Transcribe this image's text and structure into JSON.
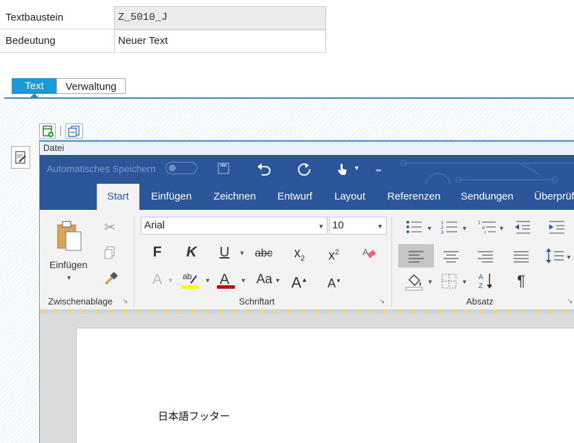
{
  "form": {
    "textbaustein_label": "Textbaustein",
    "textbaustein_value": "Z_5010_J",
    "bedeutung_label": "Bedeutung",
    "bedeutung_value": "Neuer Text"
  },
  "tabs": [
    {
      "label": "Text",
      "active": true
    },
    {
      "label": "Verwaltung",
      "active": false
    }
  ],
  "word": {
    "menu_label": "Datei",
    "autosave_label": "Automatisches Speichern",
    "ribbon_tabs": [
      "Start",
      "Einfügen",
      "Zeichnen",
      "Entwurf",
      "Layout",
      "Referenzen",
      "Sendungen",
      "Überprüfen"
    ],
    "active_ribbon_tab": "Start",
    "clipboard": {
      "paste_label": "Einfügen",
      "group_label": "Zwischenablage"
    },
    "font": {
      "family": "Arial",
      "size": "10",
      "bold_glyph": "F",
      "italic_glyph": "K",
      "underline_glyph": "U",
      "strike_glyph": "abc",
      "case_glyph": "Aa",
      "group_label": "Schriftart"
    },
    "paragraph": {
      "group_label": "Absatz"
    },
    "document_text": "日本語フッター"
  },
  "colors": {
    "accent_tab": "#1a9ad6",
    "word_blue": "#2b579a",
    "highlight_yellow": "#ffff00",
    "font_red": "#c00000"
  }
}
